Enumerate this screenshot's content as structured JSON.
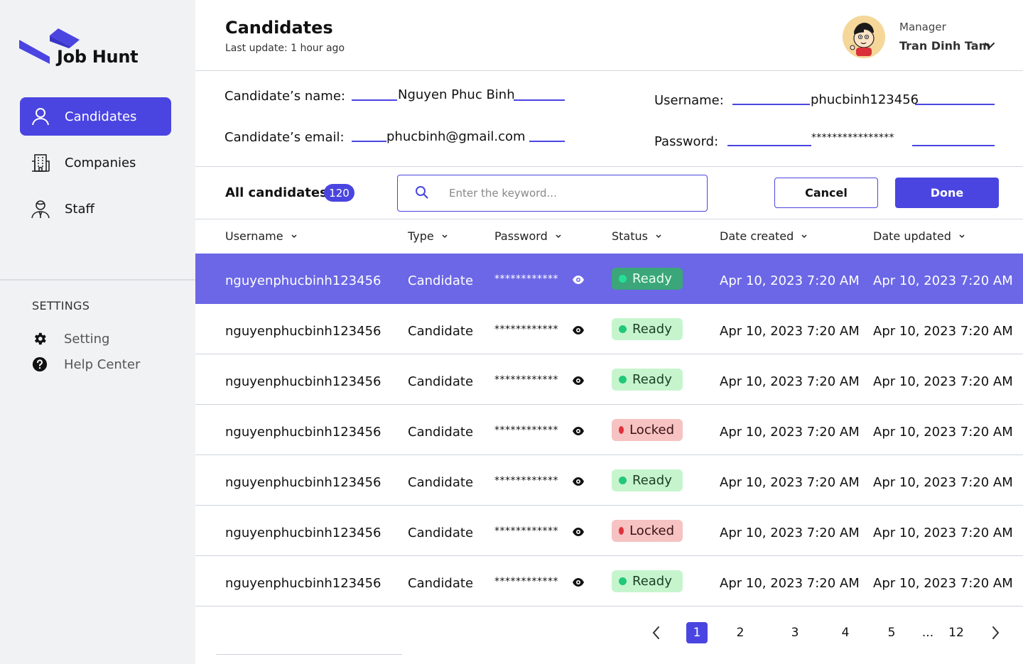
{
  "app": {
    "name": "Job Hunt"
  },
  "sidebar": {
    "items": [
      {
        "label": "Candidates",
        "icon": "user-icon",
        "active": true
      },
      {
        "label": "Companies",
        "icon": "building-icon",
        "active": false
      },
      {
        "label": "Staff",
        "icon": "staff-icon",
        "active": false
      }
    ],
    "settings_title": "SETTINGS",
    "settings_items": [
      {
        "label": "Setting",
        "icon": "gear-icon"
      },
      {
        "label": "Help Center",
        "icon": "help-icon"
      }
    ]
  },
  "header": {
    "title": "Candidates",
    "subtitle": "Last update: 1 hour ago",
    "user": {
      "role": "Manager",
      "name": "Tran Dinh Tam"
    }
  },
  "form": {
    "name_label": "Candidate’s name:",
    "name_value": "Nguyen Phuc Binh",
    "email_label": "Candidate’s email:",
    "email_value": "phucbinh@gmail.com",
    "username_label": "Username:",
    "username_value": "phucbinh123456",
    "password_label": "Password:",
    "password_value": "****************"
  },
  "toolbar": {
    "all_label": "All candidates",
    "count": "120",
    "search_placeholder": "Enter the keyword...",
    "cancel_label": "Cancel",
    "done_label": "Done"
  },
  "table": {
    "columns": [
      "Username",
      "Type",
      "Password",
      "Status",
      "Date created",
      "Date updated"
    ],
    "rows": [
      {
        "username": "nguyenphucbinh123456",
        "type": "Candidate",
        "password": "************",
        "status": "Ready",
        "created": "Apr 10, 2023 7:20 AM",
        "updated": "Apr 10, 2023 7:20 AM"
      },
      {
        "username": "nguyenphucbinh123456",
        "type": "Candidate",
        "password": "************",
        "status": "Ready",
        "created": "Apr 10, 2023 7:20 AM",
        "updated": "Apr 10, 2023 7:20 AM"
      },
      {
        "username": "nguyenphucbinh123456",
        "type": "Candidate",
        "password": "************",
        "status": "Ready",
        "created": "Apr 10, 2023 7:20 AM",
        "updated": "Apr 10, 2023 7:20 AM"
      },
      {
        "username": "nguyenphucbinh123456",
        "type": "Candidate",
        "password": "************",
        "status": "Locked",
        "created": "Apr 10, 2023 7:20 AM",
        "updated": "Apr 10, 2023 7:20 AM"
      },
      {
        "username": "nguyenphucbinh123456",
        "type": "Candidate",
        "password": "************",
        "status": "Ready",
        "created": "Apr 10, 2023 7:20 AM",
        "updated": "Apr 10, 2023 7:20 AM"
      },
      {
        "username": "nguyenphucbinh123456",
        "type": "Candidate",
        "password": "************",
        "status": "Locked",
        "created": "Apr 10, 2023 7:20 AM",
        "updated": "Apr 10, 2023 7:20 AM"
      },
      {
        "username": "nguyenphucbinh123456",
        "type": "Candidate",
        "password": "************",
        "status": "Ready",
        "created": "Apr 10, 2023 7:20 AM",
        "updated": "Apr 10, 2023 7:20 AM"
      }
    ],
    "selected_row": 0
  },
  "pagination": {
    "pages": [
      "1",
      "2",
      "3",
      "4",
      "5",
      "...",
      "12"
    ],
    "current": "1"
  },
  "colors": {
    "accent": "#4a45e0",
    "selected_row": "#6b67e6",
    "ready_bg": "#c6f5cd",
    "locked_bg": "#f6c2c2"
  }
}
